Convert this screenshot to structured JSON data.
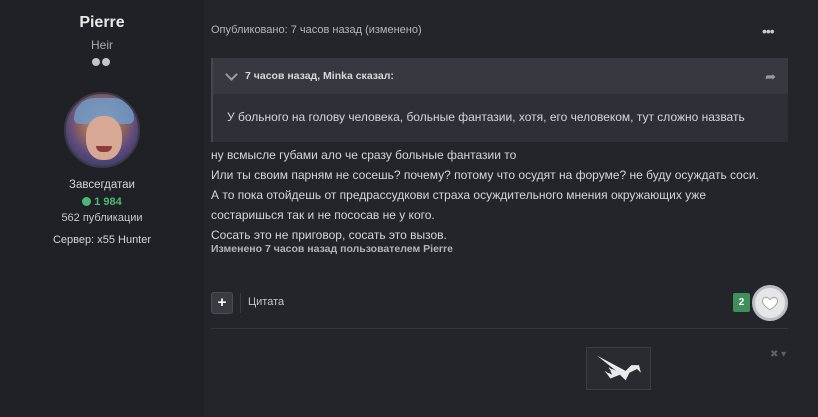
{
  "author": {
    "name": "Pierre",
    "rank_title": "Heir",
    "group": "Завсегдатаи",
    "reputation": "1 984",
    "posts": "562 публикации",
    "server": "Сервер: x55 Hunter"
  },
  "post": {
    "meta": "Опубликовано: 7 часов назад (изменено)",
    "more_icon": "ellipsis-icon",
    "quote": {
      "author": "7 часов назад, Minka сказал:",
      "text": "У больного на голову человека, больные фантазии, хотя, его человеком, тут сложно назвать"
    },
    "lines": [
      "ну всмысле губами ало че сразу больные фантазии то",
      "Или ты своим парням не сосешь? почему? потому что осудят на форуме? не буду осуждать соси.",
      "А то пока отойдешь от предрассудкови страха осуждительного мнения окружающих уже",
      "состаришься так и не пососав не у кого.",
      "Сосать это не приговор, сосать это вызов."
    ],
    "edit_note": "Изменено 7 часов назад пользователем Pierre"
  },
  "actions": {
    "add_label": "+",
    "quote_label": "Цитата",
    "reaction_count": "2",
    "reaction_icon": "heart-icon"
  },
  "colors": {
    "background": "#24252b",
    "sidebar": "#202126",
    "reputation": "#4db873",
    "badge": "#3f8f5a"
  }
}
